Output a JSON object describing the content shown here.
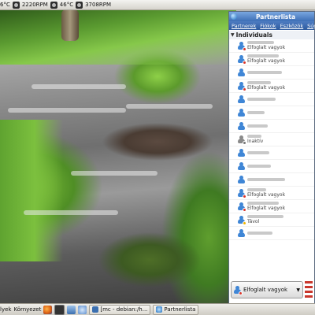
{
  "top_panel": {
    "temp1": "6°C",
    "rpm1": "2220RPM",
    "temp2": "46°C",
    "rpm2": "3708RPM"
  },
  "buddy_window": {
    "title": "Partnerlista",
    "menu": [
      "Partnerek",
      "Fiókok",
      "Eszközök",
      "Súg"
    ],
    "group_label": "Individuals",
    "buddies": [
      {
        "status": "Elfoglalt vagyok",
        "state": "busy"
      },
      {
        "status": "Elfoglalt vagyok",
        "state": "busy"
      },
      {
        "status": "",
        "state": "online"
      },
      {
        "status": "Elfoglalt vagyok",
        "state": "busy"
      },
      {
        "status": "",
        "state": "online"
      },
      {
        "status": "",
        "state": "online"
      },
      {
        "status": "",
        "state": "online"
      },
      {
        "status": "Inaktív",
        "state": "idle"
      },
      {
        "status": "",
        "state": "online"
      },
      {
        "status": "",
        "state": "online"
      },
      {
        "status": "",
        "state": "online"
      },
      {
        "status": "Elfoglalt vagyok",
        "state": "busy"
      },
      {
        "status": "Elfoglalt vagyok",
        "state": "busy"
      },
      {
        "status": "Távol",
        "state": "away"
      },
      {
        "status": "",
        "state": "online"
      }
    ],
    "status_selector": "Elfoglalt vagyok"
  },
  "bottom_panel": {
    "menu_partial": "lyek",
    "places_label": "Környezet",
    "task_mc": "[mc - debian:/h...",
    "task_pidgin": "Partnerlista"
  },
  "colors": {
    "titlebar": "#3d6fb6",
    "busy_dot": "#d9352b",
    "buddy_icon": "#3f86d6"
  }
}
